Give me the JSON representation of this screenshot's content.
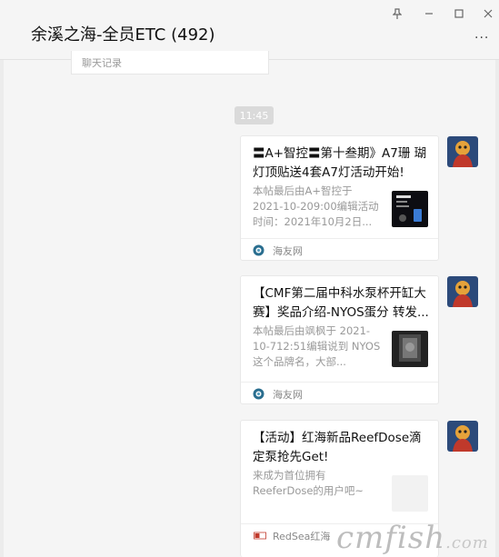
{
  "window": {
    "title": "余溪之海-全员ETC (492)",
    "pin_icon": "pin-icon",
    "minimize_icon": "minimize-icon",
    "maximize_icon": "maximize-icon",
    "close_icon": "close-icon",
    "more_label": "···"
  },
  "chat_record": {
    "label": "聊天记录"
  },
  "timestamp": "11:45",
  "messages": [
    {
      "title": "〓A+智控〓第十叁期》A7珊 瑚灯顶贴送4套A7灯活动开始!",
      "desc": "本帖最后由A+智控于 2021-10-209:00编辑活动 时间：2021年10月2日...",
      "source": "海友网"
    },
    {
      "title": "【CMF第二届中科水泵杯开缸大赛】奖品介绍-NYOS蛋分 转发...",
      "desc": "本帖最后由飒枫于 2021-10-712:51编辑说到 NYOS这个品牌名，大部...",
      "source": "海友网"
    },
    {
      "title": "【活动】红海新品ReefDose滴定泵抢先Get!",
      "desc": "来成为首位拥有 ReeferDose的用户吧~",
      "source": "RedSea红海"
    }
  ],
  "watermark": {
    "main": "cmfish",
    "suffix": ".com"
  },
  "colors": {
    "background": "#f5f5f5",
    "card": "#ffffff",
    "muted_text": "#999999",
    "time_badge": "#dadada"
  }
}
